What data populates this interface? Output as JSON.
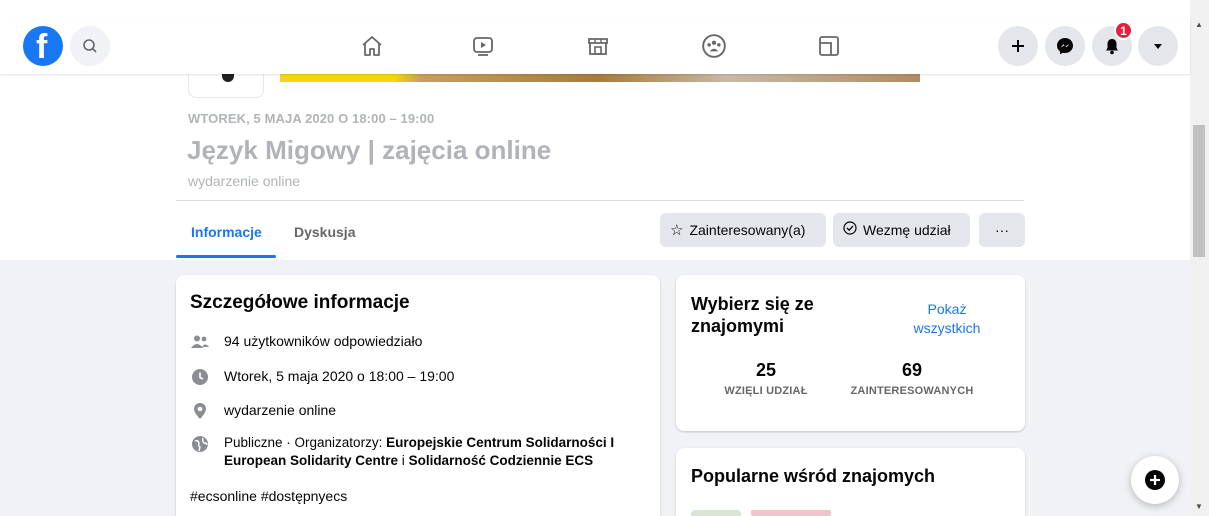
{
  "nav": {
    "logo_letter": "f",
    "notification_count": "1",
    "icons": [
      "home-icon",
      "watch-icon",
      "marketplace-icon",
      "groups-icon",
      "gaming-icon"
    ],
    "right_icons": [
      "plus-icon",
      "messenger-icon",
      "bell-icon",
      "caret-down-icon"
    ]
  },
  "event": {
    "date_line": "WTOREK, 5 MAJA 2020 O 18:00 – 19:00",
    "title": "Język Migowy | zajęcia online",
    "subtitle": "wydarzenie online"
  },
  "tabs": [
    {
      "label": "Informacje",
      "active": true
    },
    {
      "label": "Dyskusja",
      "active": false
    }
  ],
  "actions": {
    "interested": "Zainteresowany(a)",
    "going": "Wezmę udział",
    "more": "···"
  },
  "details": {
    "title": "Szczegółowe informacje",
    "responded": "94 użytkowników odpowiedziało",
    "datetime": "Wtorek, 5 maja 2020 o 18:00 – 19:00",
    "location": "wydarzenie online",
    "privacy_prefix": "Publiczne · Organizatorzy: ",
    "organizer1": "Europejskie Centrum Solidarności I European Solidarity Centre",
    "organizer_sep": " i ",
    "organizer2": "Solidarność Codziennie ECS",
    "hashtags": "#ecsonline #dostępnyecs"
  },
  "friends_card": {
    "title": "Wybierz się ze znajomymi",
    "show_all": "Pokaż wszystkich",
    "going_count": "25",
    "going_label": "WZIĘLI UDZIAŁ",
    "interested_count": "69",
    "interested_label": "ZAINTERESOWANYCH"
  },
  "popular_card": {
    "title": "Popularne wśród znajomych"
  },
  "colors": {
    "accent": "#1877f2",
    "badge": "#e41e3f",
    "background": "#f0f2f5"
  }
}
